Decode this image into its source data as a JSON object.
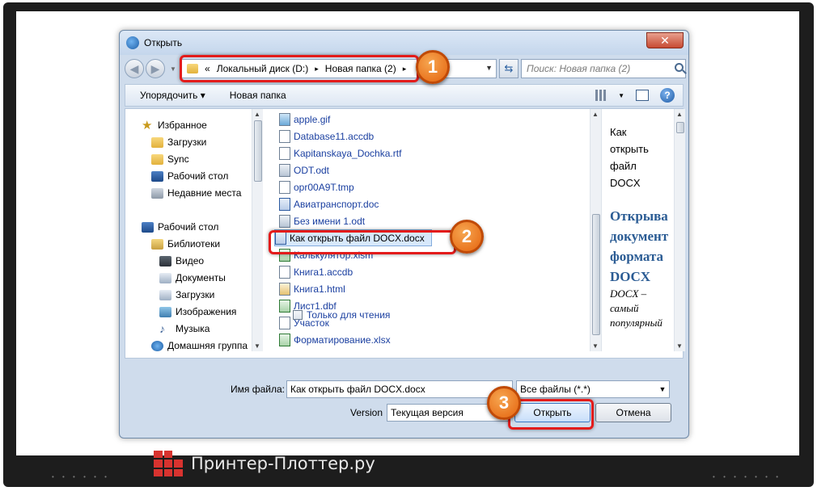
{
  "dialog": {
    "title": "Открыть",
    "close_label": "✕"
  },
  "address": {
    "prefix": "«",
    "crumbs": [
      "Локальный диск (D:)",
      "Новая папка (2)"
    ],
    "separator": "▸",
    "search_placeholder": "Поиск: Новая папка (2)"
  },
  "toolbar": {
    "organize_label": "Упорядочить ▾",
    "new_folder_label": "Новая папка",
    "help_label": "?"
  },
  "sidebar": {
    "items": [
      {
        "label": "Избранное",
        "icon": "star-icon"
      },
      {
        "label": "Загрузки",
        "icon": "folder-icon"
      },
      {
        "label": "Sync",
        "icon": "folder-icon"
      },
      {
        "label": "Рабочий стол",
        "icon": "desktop-icon"
      },
      {
        "label": "Недавние места",
        "icon": "recent-places-icon"
      },
      {
        "label": "Рабочий стол",
        "icon": "desktop-icon"
      },
      {
        "label": "Библиотеки",
        "icon": "library-icon"
      },
      {
        "label": "Видео",
        "icon": "video-icon"
      },
      {
        "label": "Документы",
        "icon": "documents-icon"
      },
      {
        "label": "Загрузки",
        "icon": "downloads-icon"
      },
      {
        "label": "Изображения",
        "icon": "images-icon"
      },
      {
        "label": "Музыка",
        "icon": "music-icon"
      },
      {
        "label": "Домашняя группа",
        "icon": "homegroup-icon"
      }
    ]
  },
  "files": [
    {
      "name": "apple.gif",
      "type": "gif"
    },
    {
      "name": "Database11.accdb",
      "type": "doc"
    },
    {
      "name": "Kapitanskaya_Dochka.rtf",
      "type": "doc"
    },
    {
      "name": "ODT.odt",
      "type": "odt"
    },
    {
      "name": "opr00A9T.tmp",
      "type": "doc"
    },
    {
      "name": "Авиатранспорт.doc",
      "type": "word"
    },
    {
      "name": "Без имени 1.odt",
      "type": "odt"
    },
    {
      "name": "Как открыть файл DOCX.docx",
      "type": "word",
      "selected": true
    },
    {
      "name": "Калькулятор.xlsm",
      "type": "excel"
    },
    {
      "name": "Книга1.accdb",
      "type": "doc"
    },
    {
      "name": "Книга1.html",
      "type": "html"
    },
    {
      "name": "Лист1.dbf",
      "type": "excel"
    },
    {
      "name": "Участок",
      "type": "doc"
    },
    {
      "name": "Форматирование.xlsx",
      "type": "excel"
    }
  ],
  "readonly_label": "Только для чтения",
  "preview": {
    "small_lines": [
      "Как",
      "открыть",
      "файл",
      "DOCX"
    ],
    "heading_lines": [
      "Открыва",
      "документ",
      "формата",
      "DOCX"
    ],
    "body_lines": [
      "DOCX –",
      "самый",
      "популярный"
    ]
  },
  "bottom": {
    "filename_label": "Имя файла:",
    "filename_value": "Как открыть файл DOCX.docx",
    "filter_value": "Все файлы (*.*)",
    "version_label": "Version",
    "version_value": "Текущая версия",
    "open_label": "Открыть",
    "cancel_label": "Отмена"
  },
  "markers": [
    "1",
    "2",
    "3"
  ],
  "watermark": "Принтер-Плоттер.ру",
  "colors": {
    "highlight": "#e31b1b",
    "marker": "#e5630e",
    "link_text": "#1a3fa0"
  }
}
